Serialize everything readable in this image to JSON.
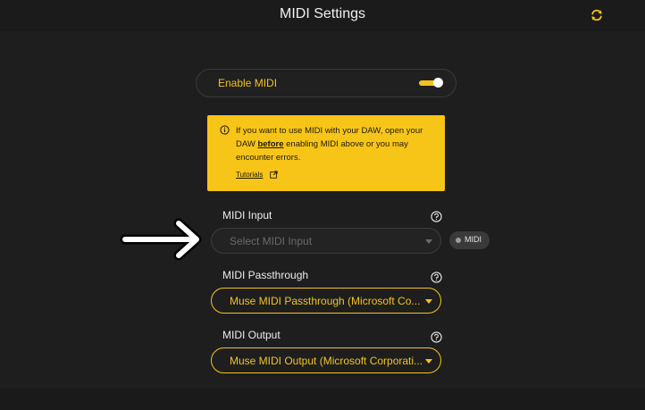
{
  "header": {
    "title": "MIDI Settings",
    "refresh_icon": "refresh-icon"
  },
  "enable_midi": {
    "label": "Enable MIDI",
    "enabled": true
  },
  "notice": {
    "text_before": "If you want to use MIDI with your DAW, open your DAW ",
    "text_emphasis": "before",
    "text_after": " enabling MIDI above or you may encounter errors.",
    "link_label": "Tutorials",
    "icon": "info-icon",
    "link_icon": "external-link-icon"
  },
  "midi_input": {
    "label": "MIDI Input",
    "placeholder": "Select MIDI Input",
    "status_chip": "MIDI",
    "help_icon": "help-icon"
  },
  "midi_passthrough": {
    "label": "MIDI Passthrough",
    "value": "Muse MIDI Passthrough (Microsoft Co...",
    "help_icon": "help-icon"
  },
  "midi_output": {
    "label": "MIDI Output",
    "value": "Muse MIDI Output (Microsoft Corporati...",
    "help_icon": "help-icon"
  },
  "colors": {
    "background": "#1e1e1e",
    "accent": "#f2c320",
    "notice_background": "#f7c517"
  }
}
